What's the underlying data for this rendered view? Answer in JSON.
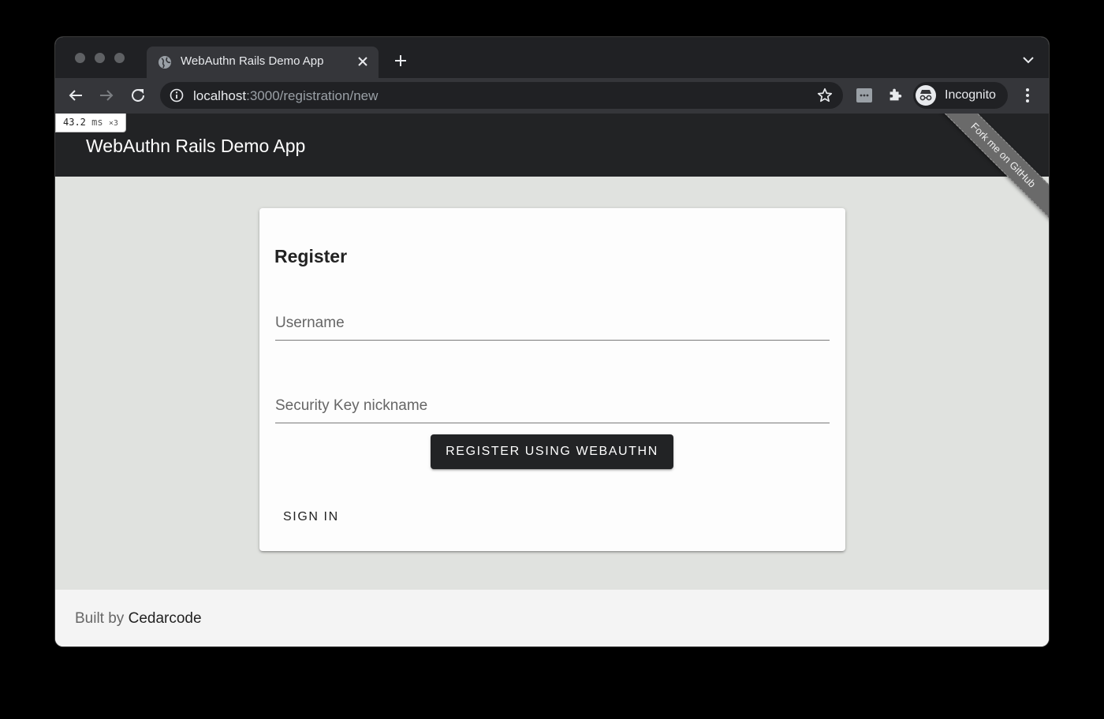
{
  "browser": {
    "tab": {
      "title": "WebAuthn Rails Demo App",
      "favicon": "globe-icon"
    },
    "url": {
      "host": "localhost",
      "rest": ":3000/registration/new"
    },
    "profile_label": "Incognito",
    "icons": [
      "back-arrow-icon",
      "forward-arrow-icon",
      "reload-icon",
      "info-icon",
      "star-icon",
      "puzzle-icon",
      "incognito-icon",
      "more-vert-icon"
    ]
  },
  "perf_badge": {
    "value": "43.2",
    "unit": "ms",
    "multiplier": "×3"
  },
  "app": {
    "title": "WebAuthn Rails Demo App",
    "ribbon": "Fork me on GitHub"
  },
  "form": {
    "title": "Register",
    "username_placeholder": "Username",
    "nickname_placeholder": "Security Key nickname",
    "submit_label": "REGISTER USING WEBAUTHN",
    "signin_label": "SIGN IN"
  },
  "footer": {
    "prefix": "Built by",
    "link": "Cedarcode"
  },
  "colors": {
    "header": "#222325",
    "page": "#e0e2df",
    "card": "#fdfdfd",
    "button": "#222325"
  }
}
